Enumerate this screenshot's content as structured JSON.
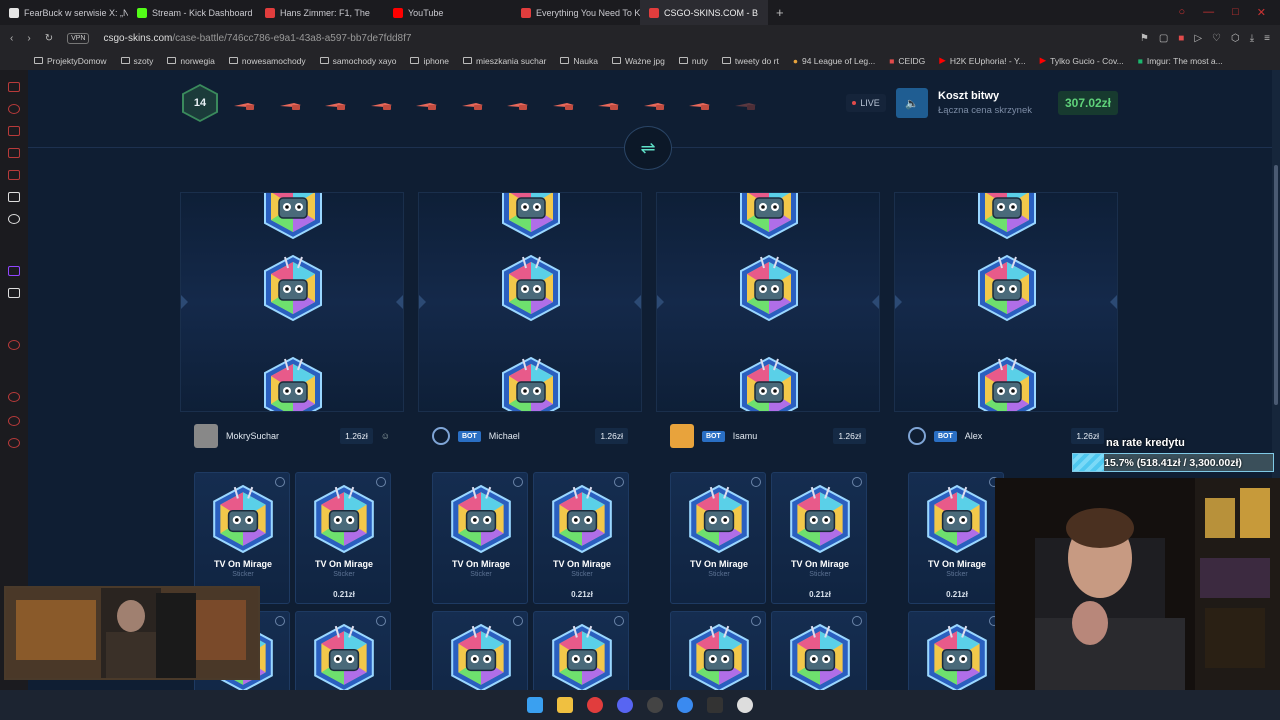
{
  "browser": {
    "tabs": [
      {
        "label": "FearBuck w serwisie X: „N",
        "color": "#e5e5e5"
      },
      {
        "label": "Stream - Kick Dashboard",
        "color": "#53fc18"
      },
      {
        "label": "Hans Zimmer: F1, The",
        "color": "#e13d3d"
      },
      {
        "label": "YouTube",
        "color": "#ff0000"
      },
      {
        "label": "Everything You Need To K",
        "color": "#e13d3d"
      },
      {
        "label": "CSGO-SKINS.COM - B",
        "color": "#e13d3d"
      }
    ],
    "new_tab": "+",
    "vpn": "VPN",
    "url_domain": "csgo-skins.com",
    "url_path": "/case-battle/746cc786-e9a1-43a8-a597-bb7de7fdd8f7",
    "bookmarks": [
      "ProjektyDomow",
      "szoty",
      "norwegia",
      "nowesamochody",
      "samochody xayo",
      "iphone",
      "mieszkania suchar",
      "Nauka",
      "Ważne jpg",
      "nuty",
      "tweety do rt",
      "94 League of Leg...",
      "CEIDG",
      "H2K EUphoria! - Y...",
      "Tylko Gucio - Cov...",
      "Imgur: The most a..."
    ]
  },
  "battle": {
    "round": "14",
    "live_label": "LIVE",
    "cost_title": "Koszt bitwy",
    "cost_subtitle": "Łączna cena skrzynek",
    "cost_value": "307.02zł",
    "players": [
      {
        "name": "MokrySuchar",
        "amount": "1.26zł",
        "bot": false
      },
      {
        "name": "Michael",
        "amount": "1.26zł",
        "bot": true
      },
      {
        "name": "Isamu",
        "amount": "1.26zł",
        "bot": true
      },
      {
        "name": "Alex",
        "amount": "1.26zł",
        "bot": true
      }
    ],
    "bot_label": "BOT",
    "item": {
      "name": "TV On Mirage",
      "type": "Sticker",
      "price": "0.21zł"
    }
  },
  "overlay": {
    "label": "na rate kredytu",
    "progress_text": "15.7% (518.41zł / 3,300.00zł)",
    "progress_fraction": 0.157
  }
}
